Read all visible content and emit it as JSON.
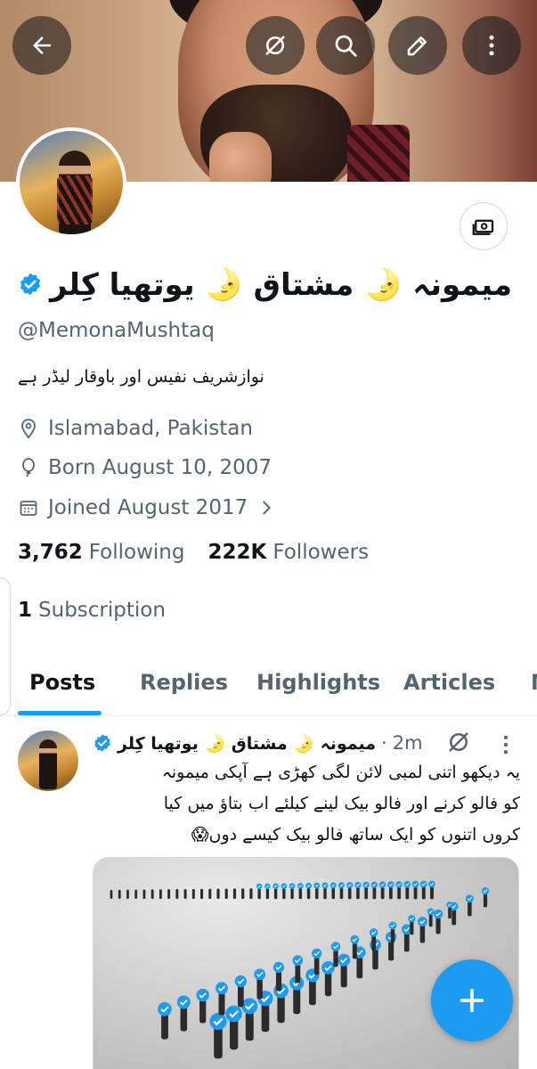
{
  "header": {
    "back_label": "Back",
    "actions": [
      "grok-icon",
      "search-icon",
      "edit-icon",
      "more-vertical-icon"
    ]
  },
  "profile": {
    "display_name": "میمونہ 🌛 مشتاق 🌛 یوتھیا کِلر",
    "handle": "@MemonaMushtaq",
    "bio": "نوازشریف نفیس اور باوقار لیڈر ہے",
    "location": "Islamabad, Pakistan",
    "birthday": "Born August 10, 2007",
    "joined": "Joined August 2017",
    "following_count": "3,762",
    "following_label": "Following",
    "followers_count": "222K",
    "followers_label": "Followers",
    "subscription_count": "1",
    "subscription_label": "Subscription"
  },
  "tabs": [
    {
      "label": "Posts"
    },
    {
      "label": "Replies"
    },
    {
      "label": "Highlights"
    },
    {
      "label": "Articles"
    },
    {
      "label": "M"
    }
  ],
  "post": {
    "author": "میمونہ 🌛 مشتاق 🌛 یوتھیا کِلر",
    "separator": "·",
    "time": "2m",
    "text_line1": "یہ دیکھو اتنی لمبی لائن لگی کھڑی ہے آپکی میمونہ",
    "text_line2": "کو فالو کرنے اور فالو بیک لینے کیلئے اب بتاؤ میں کیا",
    "text_line3": "کروں اتنوں کو ایک ساتھ فالو بیک کیسے دوں😱"
  },
  "colors": {
    "accent": "#1d9bf0",
    "text_primary": "#0f1419",
    "text_secondary": "#536471"
  }
}
